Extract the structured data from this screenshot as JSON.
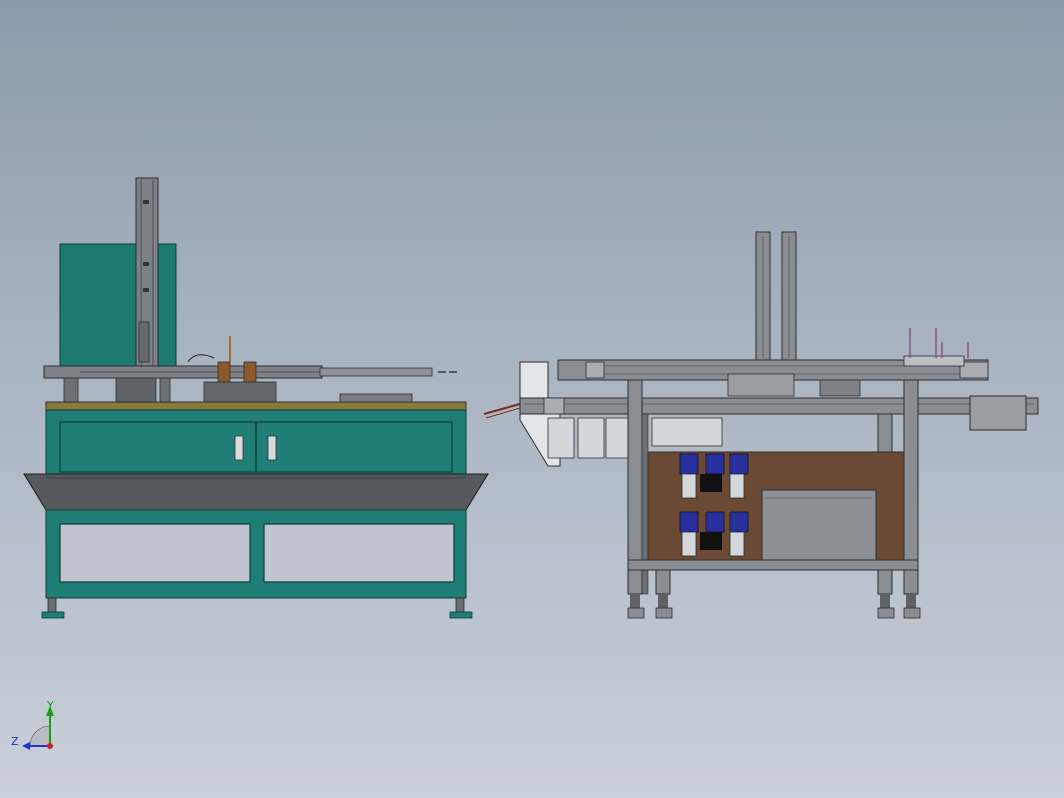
{
  "view": {
    "orientation_triad": {
      "y_label": "Y",
      "z_label": "Z",
      "y_color": "#1a9a1a",
      "z_color": "#2233cc",
      "origin_color": "#cc2222"
    }
  },
  "colors": {
    "frame_teal": "#1f7f76",
    "frame_teal_dark": "#135c55",
    "teal_panel": "#1d7a70",
    "steel": "#8a8e93",
    "steel_dark": "#4e5257",
    "brown_panel": "#6b4a35",
    "motor_blue": "#2a2fa0",
    "tray_gray": "#55585c",
    "wood_top": "#8a7a3a"
  }
}
